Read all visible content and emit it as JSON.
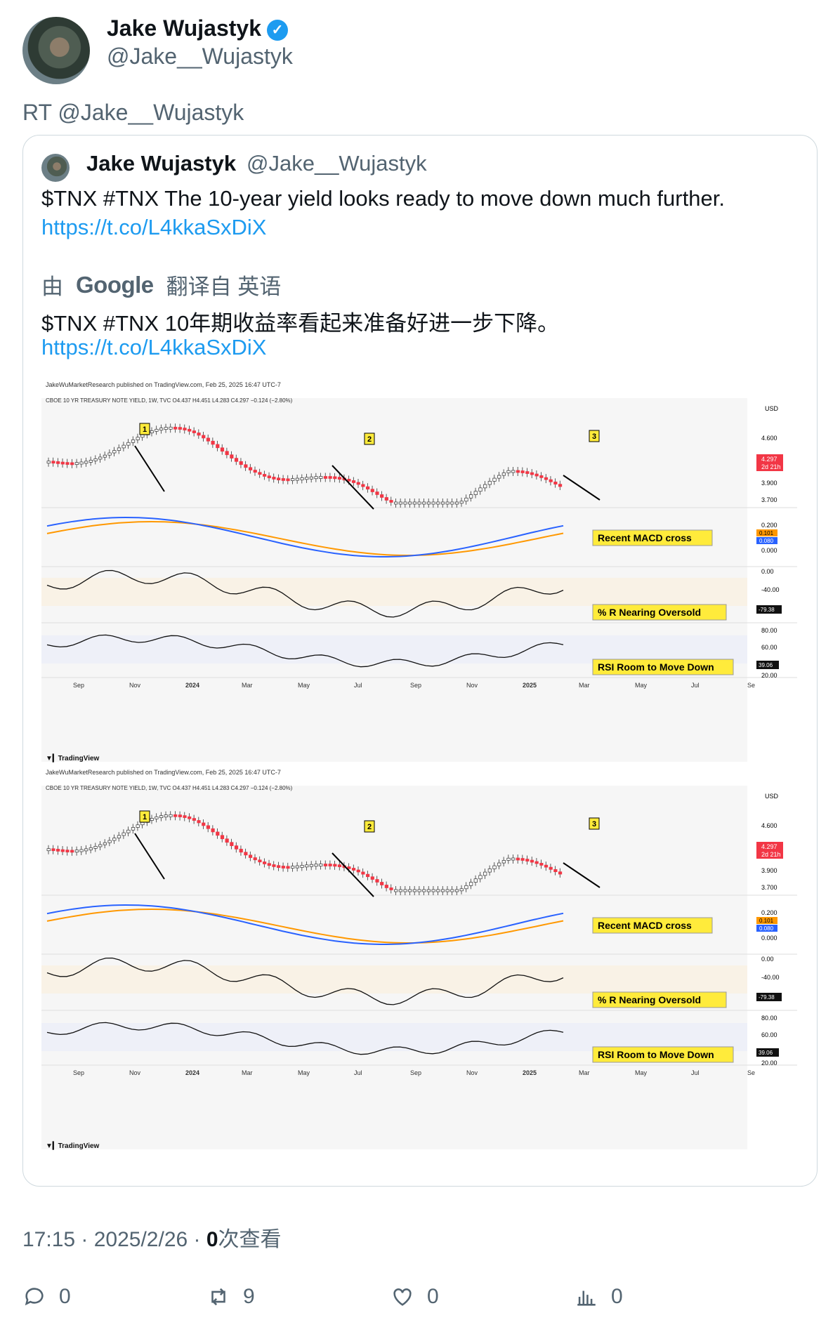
{
  "tweet": {
    "author_name": "Jake Wujastyk",
    "handle": "@Jake__Wujastyk",
    "retweet_label": "RT @Jake__Wujastyk"
  },
  "quote": {
    "author_name": "Jake Wujastyk",
    "handle": "@Jake__Wujastyk",
    "text": "$TNX #TNX The 10-year yield looks ready to move down much further.",
    "link": "https://t.co/L4kkaSxDiX",
    "translation_prefix": "由",
    "translation_brand": "Google",
    "translation_suffix": "翻译自 英语",
    "translated_text": "$TNX #TNX 10年期收益率看起来准备好进一步下降。",
    "translated_link": "https://t.co/L4kkaSxDiX"
  },
  "chart": {
    "publish_line": "JakeWuMarketResearch published on TradingView.com, Feb 25, 2025 16:47 UTC-7",
    "symbol_line": "CBOE 10 YR TREASURY NOTE YIELD, 1W, TVC",
    "ohlc": {
      "o": "O4.437",
      "h": "H4.451",
      "l": "L4.283",
      "c": "C4.297",
      "chg": "−0.124 (−2.80%)"
    },
    "currency": "USD",
    "price_ticks": [
      "4.600",
      "3.900",
      "3.700"
    ],
    "last_price": "4.297",
    "countdown": "2d 21h",
    "macd_ticks": [
      "0.200",
      "0.000"
    ],
    "macd_values": [
      "0.101",
      "0.080"
    ],
    "wr_ticks": [
      "0.00",
      "-40.00"
    ],
    "wr_value": "-79.38",
    "rsi_ticks": [
      "80.00",
      "60.00",
      "20.00"
    ],
    "rsi_value": "39.06",
    "labels": {
      "macd": "Recent MACD cross",
      "wr": "% R Nearing Oversold",
      "rsi": "RSI Room to Move Down"
    },
    "markers": [
      "1",
      "2",
      "3"
    ],
    "x_ticks": [
      "Sep",
      "Nov",
      "2024",
      "Mar",
      "May",
      "Jul",
      "Sep",
      "Nov",
      "2025",
      "Mar",
      "May",
      "Jul",
      "Se"
    ],
    "branding": "TradingView",
    "colors": {
      "up": "#ffffff",
      "down": "#f23645",
      "macd": "#2962ff",
      "signal": "#ff9800",
      "label_bg": "#ffeb3b"
    }
  },
  "footer": {
    "time": "17:15 · 2025/2/26 · ",
    "views_count": "0",
    "views_label": "次查看"
  },
  "actions": {
    "replies": "0",
    "retweets": "9",
    "likes": "0",
    "views": "0"
  }
}
